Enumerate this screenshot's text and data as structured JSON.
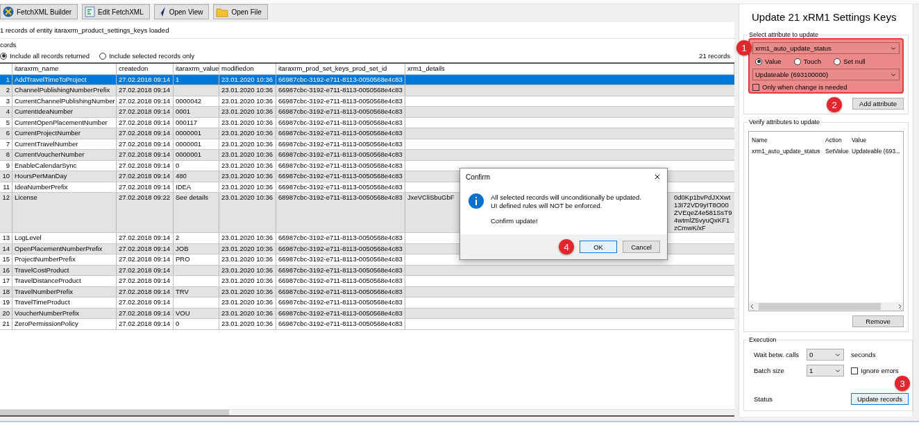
{
  "toolbar": {
    "buttons": [
      {
        "label": "FetchXML Builder",
        "kind": "fxb"
      },
      {
        "label": "Edit FetchXML",
        "kind": "edit"
      },
      {
        "label": "Open View",
        "kind": "view"
      },
      {
        "label": "Open File",
        "kind": "file"
      }
    ]
  },
  "status_text": "1 records of entity itaraxrm_product_settings_keys loaded",
  "records_group": {
    "title": "cords",
    "options": [
      {
        "label": "Include all records returned",
        "selected": true
      },
      {
        "label": "Include selected records only",
        "selected": false
      }
    ],
    "count": "21 records"
  },
  "table": {
    "columns": [
      "itaraxrm_name",
      "createdon",
      "itaraxrm_value",
      "modifiedon",
      "itaraxrm_prod_set_keys_prod_set_id",
      "xrm1_details"
    ],
    "rows": [
      {
        "number": "1",
        "name": "AddTravelTimeToProject",
        "createdon": "27.02.2018 09:14",
        "value": "1",
        "modifiedon": "23.01.2020 10:36",
        "set_id": "66987cbc-3192-e711-8113-0050568e4c83",
        "selected": true
      },
      {
        "number": "2",
        "name": "ChannelPublishingNumberPrefix",
        "createdon": "27.02.2018 09:14",
        "modifiedon": "23.01.2020 10:36",
        "set_id": "66987cbc-3192-e711-8113-0050568e4c83",
        "selected": false
      },
      {
        "number": "3",
        "name": "CurrentChannelPublishingNumber",
        "createdon": "27.02.2018 09:14",
        "value": "0000042",
        "modifiedon": "23.01.2020 10:36",
        "set_id": "66987cbc-3192-e711-8113-0050568e4c83",
        "selected": false
      },
      {
        "number": "4",
        "name": "CurrentIdeaNumber",
        "createdon": "27.02.2018 09:14",
        "value": "0001",
        "modifiedon": "23.01.2020 10:36",
        "set_id": "66987cbc-3192-e711-8113-0050568e4c83",
        "selected": false
      },
      {
        "number": "5",
        "name": "CurrentOpenPlacementNumber",
        "createdon": "27.02.2018 09:14",
        "value": "000117",
        "modifiedon": "23.01.2020 10:36",
        "set_id": "66987cbc-3192-e711-8113-0050568e4c83",
        "selected": false
      },
      {
        "number": "6",
        "name": "CurrentProjectNumber",
        "createdon": "27.02.2018 09:14",
        "value": "0000001",
        "modifiedon": "23.01.2020 10:36",
        "set_id": "66987cbc-3192-e711-8113-0050568e4c83",
        "selected": false
      },
      {
        "number": "7",
        "name": "CurrentTravelNumber",
        "createdon": "27.02.2018 09:14",
        "value": "0000001",
        "modifiedon": "23.01.2020 10:36",
        "set_id": "66987cbc-3192-e711-8113-0050568e4c83",
        "selected": false
      },
      {
        "number": "8",
        "name": "CurrentVoucherNumber",
        "createdon": "27.02.2018 09:14",
        "value": "0000001",
        "modifiedon": "23.01.2020 10:36",
        "set_id": "66987cbc-3192-e711-8113-0050568e4c83",
        "selected": false
      },
      {
        "number": "9",
        "name": "EnableCalendarSync",
        "createdon": "27.02.2018 09:14",
        "value": "0",
        "modifiedon": "23.01.2020 10:36",
        "set_id": "66987cbc-3192-e711-8113-0050568e4c83",
        "selected": false
      },
      {
        "number": "10",
        "name": "HoursPerManDay",
        "createdon": "27.02.2018 09:14",
        "value": "480",
        "modifiedon": "23.01.2020 10:36",
        "set_id": "66987cbc-3192-e711-8113-0050568e4c83",
        "selected": false
      },
      {
        "number": "11",
        "name": "IdeaNumberPrefix",
        "createdon": "27.02.2018 09:14",
        "value": "IDEA",
        "modifiedon": "23.01.2020 10:36",
        "set_id": "66987cbc-3192-e711-8113-0050568e4c83",
        "selected": false
      },
      {
        "number": "12",
        "name": "License",
        "createdon": "27.02.2018 09:22",
        "value": "See details",
        "modifiedon": "23.01.2020 10:36",
        "set_id": "68987cbc-3192-e711-8113-0050568e4c83",
        "details": [
          "JxeVCliSbuGbF",
          "0d0Kp1bvPdJXXwt13I72VD9yIT8O00ZVEqeZ4e581SsT94wtmlZ5vyuQxKF1zCmwK/xF"
        ],
        "selected": false
      },
      {
        "number": "13",
        "name": "LogLevel",
        "createdon": "27.02.2018 09:14",
        "value": "2",
        "modifiedon": "23.01.2020 10:36",
        "set_id": "66987cbc-3192-e711-8113-0050568e4c83",
        "selected": false
      },
      {
        "number": "14",
        "name": "OpenPlacementNumberPrefix",
        "createdon": "27.02.2018 09:14",
        "value": "JOB",
        "modifiedon": "23.01.2020 10:36",
        "set_id": "66987cbc-3192-e711-8113-0050568e4c83",
        "selected": false
      },
      {
        "number": "15",
        "name": "ProjectNumberPrefix",
        "createdon": "27.02.2018 09:14",
        "value": "PRO",
        "modifiedon": "23.01.2020 10:36",
        "set_id": "66987cbc-3192-e711-8113-0050568e4c83",
        "selected": false
      },
      {
        "number": "16",
        "name": "TravelCostProduct",
        "createdon": "27.02.2018 09:14",
        "modifiedon": "23.01.2020 10:36",
        "set_id": "66987cbc-3192-e711-8113-0050568e4c83",
        "selected": false
      },
      {
        "number": "17",
        "name": "TravelDistanceProduct",
        "createdon": "27.02.2018 09:14",
        "modifiedon": "23.01.2020 10:36",
        "set_id": "66987cbc-3192-e711-8113-0050568e4c83",
        "selected": false
      },
      {
        "number": "18",
        "name": "TravelNumberPrefix",
        "createdon": "27.02.2018 09:14",
        "value": "TRV",
        "modifiedon": "23.01.2020 10:36",
        "set_id": "66987cbc-3192-e711-8113-0050568e4c83",
        "selected": false
      },
      {
        "number": "19",
        "name": "TravelTimeProduct",
        "createdon": "27.02.2018 09:14",
        "modifiedon": "23.01.2020 10:36",
        "set_id": "66987cbc-3192-e711-8113-0050568e4c83",
        "selected": false
      },
      {
        "number": "20",
        "name": "VoucherNumberPrefix",
        "createdon": "27.02.2018 09:14",
        "value": "VOU",
        "modifiedon": "23.01.2020 10:36",
        "set_id": "66987cbc-3192-e711-8113-0050568e4c83",
        "selected": false
      },
      {
        "number": "21",
        "name": "ZeroPermissionPolicy",
        "createdon": "27.02.2018 09:14",
        "value": "0",
        "modifiedon": "23.01.2020 10:36",
        "set_id": "66987cbc-3192-e711-8113-0050568e4c83",
        "selected": false
      }
    ]
  },
  "dialog": {
    "title": "Confirm",
    "message": [
      "All selected records will unconditionally be updated.",
      "UI defined rules will NOT be enforced."
    ],
    "question": "Confirm update!",
    "marker": "4",
    "buttons": [
      {
        "label": "OK",
        "focused": true
      },
      {
        "label": "Cancel",
        "focused": false
      }
    ]
  },
  "panel": {
    "title": "Update 21 xRM1 Settings Keys",
    "select_group": {
      "title": "Select attribute to update",
      "marker": "1",
      "attribute": "xrm1_auto_update_status",
      "modes": [
        {
          "label": "Value",
          "selected": true
        },
        {
          "label": "Touch",
          "selected": false
        },
        {
          "label": "Set null",
          "selected": false
        }
      ],
      "value": "Updateable (693100000)",
      "only_when_needed": {
        "label": "Only when change is needed",
        "checked": false
      },
      "add_button": {
        "label": "Add attribute",
        "marker": "2"
      }
    },
    "verify_group": {
      "title": "Verify attributes to update",
      "columns": [
        "Name",
        "Action",
        "Value"
      ],
      "rows": [
        {
          "name": "xrm1_auto_update_status",
          "action": "SetValue",
          "value": "Updateable (693..."
        }
      ],
      "remove_button": "Remove"
    },
    "execution": {
      "title": "Execution",
      "wait_label": "Wait betw. calls",
      "wait_value": "0",
      "wait_unit": "seconds",
      "batch_label": "Batch size",
      "batch_value": "1",
      "ignore_errors": {
        "label": "Ignore errors",
        "checked": false
      },
      "status_label": "Status",
      "update_button": {
        "label": "Update records",
        "focused": true,
        "marker": "3"
      }
    }
  }
}
